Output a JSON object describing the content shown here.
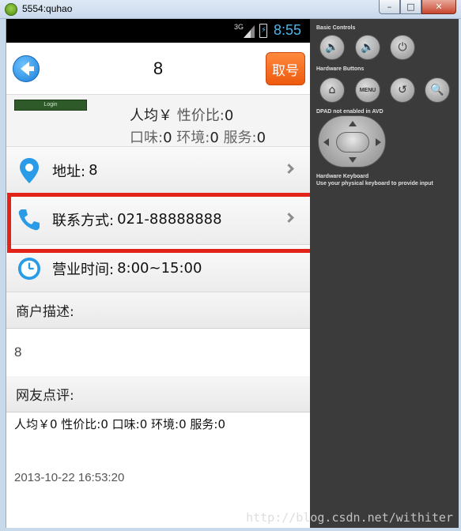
{
  "window": {
    "title": "5554:quhao",
    "controls": {
      "minimize": "–",
      "maximize": "□",
      "close": "✕"
    }
  },
  "statusbar": {
    "network": "3G",
    "time": "8:55",
    "accent": "#4cb6e8"
  },
  "header": {
    "title": "8",
    "take_number_label": "取号",
    "accent": "#ee5a0e"
  },
  "info": {
    "login_image_text": "Login",
    "avg_label": "人均￥",
    "value_ratio_label": "性价比:",
    "value_ratio": "0",
    "taste_label": "口味:",
    "taste": "0",
    "environment_label": "环境:",
    "environment": "0",
    "service_label": "服务:",
    "service": "0"
  },
  "rows": {
    "address": {
      "label": "地址:",
      "value": "8",
      "icon": "location-pin-icon"
    },
    "contact": {
      "label": "联系方式:",
      "value": "021-88888888",
      "icon": "phone-icon"
    },
    "hours": {
      "label": "营业时间:",
      "value": "8:00~15:00",
      "icon": "clock-icon"
    }
  },
  "description": {
    "heading": "商户描述:",
    "text": "8"
  },
  "reviews": {
    "heading": "网友点评:",
    "summary": "人均￥0  性价比:0  口味:0  环境:0  服务:0",
    "timestamp": "2013-10-22 16:53:20"
  },
  "panel": {
    "basic_controls_label": "Basic Controls",
    "hardware_buttons_label": "Hardware Buttons",
    "menu_label": "MENU",
    "dpad_label": "DPAD not enabled in AVD",
    "keyboard_label_1": "Hardware Keyboard",
    "keyboard_label_2": "Use your physical keyboard to provide input"
  },
  "watermark": "http://blog.csdn.net/withiter",
  "highlight_color": "#e2231a"
}
